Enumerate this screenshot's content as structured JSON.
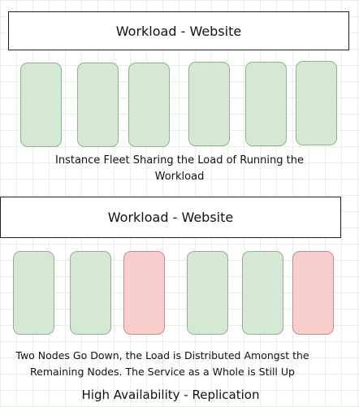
{
  "top_panel": {
    "workload_title": "Workload - Website",
    "nodes": [
      {
        "status": "up"
      },
      {
        "status": "up"
      },
      {
        "status": "up"
      },
      {
        "status": "up"
      },
      {
        "status": "up"
      },
      {
        "status": "up"
      }
    ],
    "caption_line1": "Instance Fleet Sharing the Load of Running the",
    "caption_line2": "Workload"
  },
  "bottom_panel": {
    "workload_title": "Workload - Website",
    "nodes": [
      {
        "status": "up"
      },
      {
        "status": "up"
      },
      {
        "status": "down"
      },
      {
        "status": "up"
      },
      {
        "status": "up"
      },
      {
        "status": "down"
      }
    ],
    "caption_line1": "Two Nodes Go Down, the Load is Distributed Amongst the",
    "caption_line2": "Remaining Nodes. The Service as a Whole is Still Up"
  },
  "footer_title": "High Availability - Replication",
  "colors": {
    "node_up_fill": "#d5e8d4",
    "node_up_border": "#8fb38a",
    "node_down_fill": "#f8cecc",
    "node_down_border": "#c98a87"
  }
}
